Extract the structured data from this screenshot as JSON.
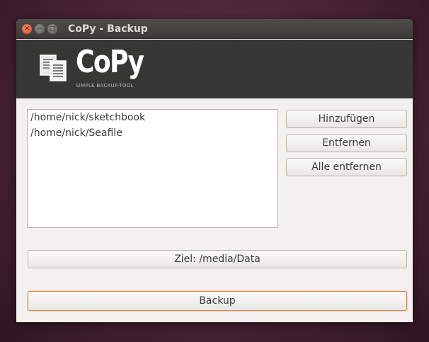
{
  "window": {
    "title": "CoPy - Backup"
  },
  "window_controls": [
    {
      "name": "close",
      "icon": "close-icon"
    },
    {
      "name": "minimize",
      "icon": "minimize-icon"
    },
    {
      "name": "maximize",
      "icon": "maximize-icon"
    }
  ],
  "banner": {
    "logo_text": "CoPy",
    "tagline": "SIMPLE BACKUP-TOOL",
    "logo_icon": "documents-icon"
  },
  "sources": {
    "items": [
      {
        "path": "/home/nick/sketchbook"
      },
      {
        "path": "/home/nick/Seafile"
      }
    ]
  },
  "buttons": {
    "add": "Hinzufügen",
    "remove": "Entfernen",
    "remove_all": "Alle entfernen",
    "target": "Ziel: /media/Data",
    "backup": "Backup"
  },
  "colors": {
    "titlebar": "#3c3b37",
    "banner": "#353533",
    "window_bg": "#f2f1f0",
    "focus_accent": "#e27a4a",
    "close_button": "#de4a1f"
  }
}
